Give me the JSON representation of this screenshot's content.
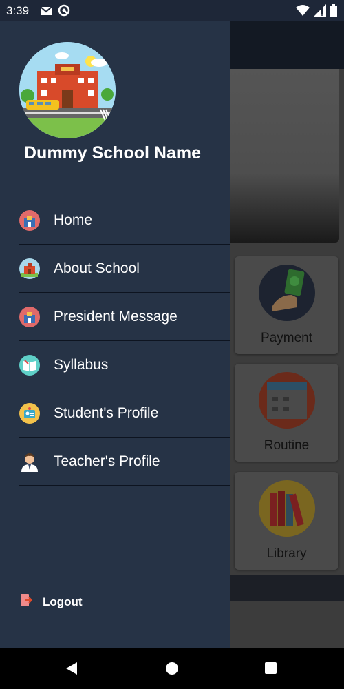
{
  "status_bar": {
    "time": "3:39",
    "icons": [
      "gmail-icon",
      "sync-icon",
      "wifi-icon",
      "signal-icon",
      "battery-icon"
    ]
  },
  "drawer": {
    "school_name": "Dummy School Name",
    "items": [
      {
        "label": "Home",
        "icon": "school-home-icon"
      },
      {
        "label": "About School",
        "icon": "school-building-icon"
      },
      {
        "label": "President Message",
        "icon": "president-icon"
      },
      {
        "label": "Syllabus",
        "icon": "syllabus-book-icon"
      },
      {
        "label": "Student's Profile",
        "icon": "student-id-icon"
      },
      {
        "label": "Teacher's Profile",
        "icon": "teacher-icon"
      }
    ],
    "logout_label": "Logout"
  },
  "background_cards": [
    {
      "label": "Payment",
      "icon": "payment-icon"
    },
    {
      "label": "Routine",
      "icon": "calendar-icon"
    },
    {
      "label": "Library",
      "icon": "books-icon"
    }
  ],
  "colors": {
    "drawer_bg": "#263346",
    "divider": "#0d1420",
    "text": "#ffffff"
  }
}
